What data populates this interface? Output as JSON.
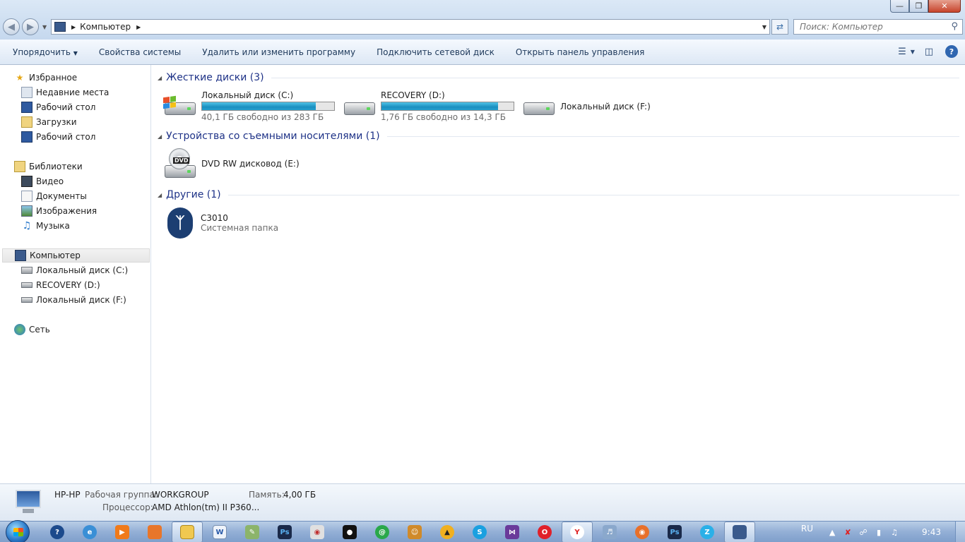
{
  "window": {
    "address": {
      "location": "Компьютер"
    },
    "search": {
      "placeholder": "Поиск: Компьютер"
    }
  },
  "toolbar": {
    "organize": "Упорядочить",
    "system_properties": "Свойства системы",
    "uninstall": "Удалить или изменить программу",
    "map_drive": "Подключить сетевой диск",
    "control_panel": "Открыть панель управления"
  },
  "sidebar": {
    "favorites": {
      "label": "Избранное",
      "items": [
        "Недавние места",
        "Рабочий стол",
        "Загрузки",
        "Рабочий стол"
      ]
    },
    "libraries": {
      "label": "Библиотеки",
      "items": [
        "Видео",
        "Документы",
        "Изображения",
        "Музыка"
      ]
    },
    "computer": {
      "label": "Компьютер",
      "items": [
        "Локальный диск (C:)",
        "RECOVERY (D:)",
        "Локальный диск (F:)"
      ]
    },
    "network": {
      "label": "Сеть"
    }
  },
  "content": {
    "hard_drives": {
      "header": "Жесткие диски (3)",
      "drives": [
        {
          "name": "Локальный диск (C:)",
          "free": "40,1 ГБ свободно из 283 ГБ",
          "used_fraction": 0.86
        },
        {
          "name": "RECOVERY (D:)",
          "free": "1,76 ГБ свободно из 14,3 ГБ",
          "used_fraction": 0.88
        },
        {
          "name": "Локальный диск (F:)"
        }
      ]
    },
    "removable": {
      "header": "Устройства со съемными носителями (1)",
      "items": [
        {
          "name": "DVD RW дисковод (E:)"
        }
      ]
    },
    "other": {
      "header": "Другие (1)",
      "items": [
        {
          "name": "C3010",
          "sub": "Системная папка"
        }
      ]
    }
  },
  "details": {
    "name": "HP-HP",
    "workgroup_label": "Рабочая группа:",
    "workgroup": "WORKGROUP",
    "memory_label": "Память:",
    "memory": "4,00 ГБ",
    "cpu_label": "Процессор:",
    "cpu": "AMD Athlon(tm) II P360..."
  },
  "taskbar": {
    "language": "RU",
    "clock": "9:43"
  },
  "colors": {
    "accent": "#1e3287",
    "bar_fill": "#26a0cf",
    "toolbar_text": "#1e395b"
  }
}
